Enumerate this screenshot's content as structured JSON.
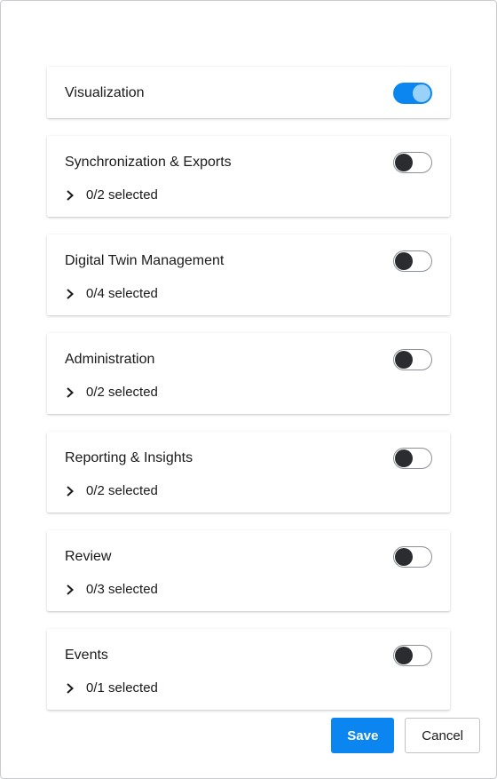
{
  "sections": [
    {
      "title": "Visualization",
      "enabled": true,
      "selected_text": null
    },
    {
      "title": "Synchronization & Exports",
      "enabled": false,
      "selected_text": "0/2 selected"
    },
    {
      "title": "Digital Twin Management",
      "enabled": false,
      "selected_text": "0/4 selected"
    },
    {
      "title": "Administration",
      "enabled": false,
      "selected_text": "0/2 selected"
    },
    {
      "title": "Reporting & Insights",
      "enabled": false,
      "selected_text": "0/2 selected"
    },
    {
      "title": "Review",
      "enabled": false,
      "selected_text": "0/3 selected"
    },
    {
      "title": "Events",
      "enabled": false,
      "selected_text": "0/1 selected"
    }
  ],
  "footer": {
    "save_label": "Save",
    "cancel_label": "Cancel"
  }
}
